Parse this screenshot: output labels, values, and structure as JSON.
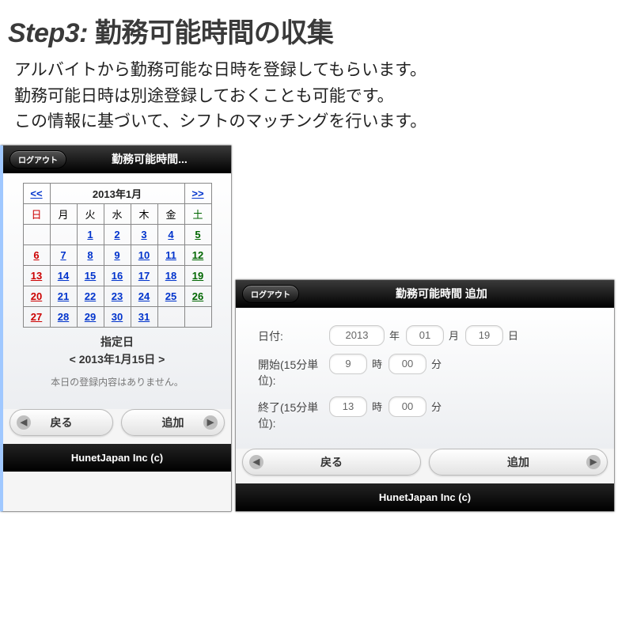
{
  "header": {
    "step_label": "Step3:",
    "title": "勤務可能時間の収集",
    "desc_line1": "アルバイトから勤務可能な日時を登録してもらいます。",
    "desc_line2": "勤務可能日時は別途登録しておくことも可能です。",
    "desc_line3": "この情報に基づいて、シフトのマッチングを行います。"
  },
  "common": {
    "logout_label": "ログアウト",
    "footer": "HunetJapan Inc (c)",
    "back_label": "戻る",
    "add_label": "追加"
  },
  "left": {
    "title": "勤務可能時間...",
    "month_label": "2013年1月",
    "prev": "<<",
    "next": ">>",
    "dow": [
      "日",
      "月",
      "火",
      "水",
      "木",
      "金",
      "土"
    ],
    "weeks": [
      [
        "",
        "",
        "1",
        "2",
        "3",
        "4",
        "5"
      ],
      [
        "6",
        "7",
        "8",
        "9",
        "10",
        "11",
        "12"
      ],
      [
        "13",
        "14",
        "15",
        "16",
        "17",
        "18",
        "19"
      ],
      [
        "20",
        "21",
        "22",
        "23",
        "24",
        "25",
        "26"
      ],
      [
        "27",
        "28",
        "29",
        "30",
        "31",
        "",
        ""
      ]
    ],
    "selected_label": "指定日",
    "selected_date": "< 2013年1月15日 >",
    "empty_msg": "本日の登録内容はありません。"
  },
  "right": {
    "title": "勤務可能時間 追加",
    "date_label": "日付:",
    "date_year": "2013",
    "date_year_unit": "年",
    "date_month": "01",
    "date_month_unit": "月",
    "date_day": "19",
    "date_day_unit": "日",
    "start_label": "開始(15分単位):",
    "start_hour": "9",
    "hour_unit": "時",
    "start_min": "00",
    "min_unit": "分",
    "end_label": "終了(15分単位):",
    "end_hour": "13",
    "end_min": "00"
  }
}
